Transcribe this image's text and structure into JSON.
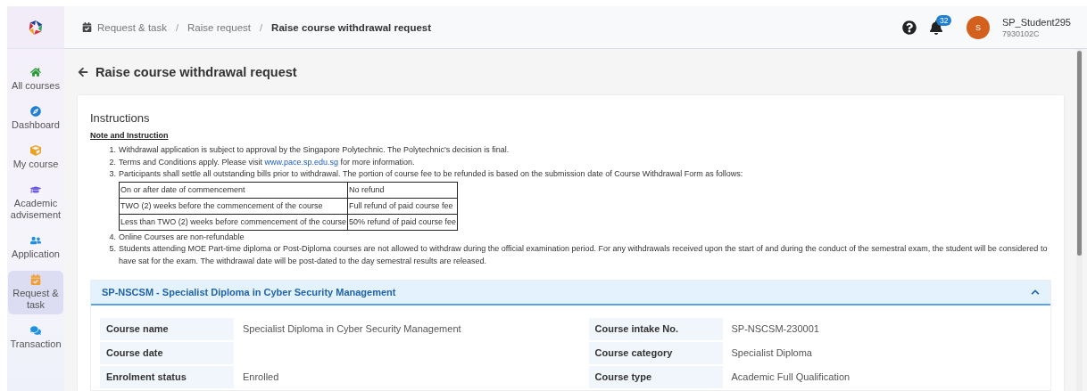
{
  "sidebar": {
    "items": [
      {
        "label": "All courses",
        "selected": false
      },
      {
        "label": "Dashboard",
        "selected": false
      },
      {
        "label": "My course",
        "selected": false
      },
      {
        "label": "Academic advisement",
        "selected": false
      },
      {
        "label": "Application",
        "selected": false
      },
      {
        "label": "Request & task",
        "selected": true
      },
      {
        "label": "Transaction",
        "selected": false
      }
    ]
  },
  "breadcrumb": [
    {
      "label": "Request & task",
      "current": false
    },
    {
      "separator": "/",
      "label": "Raise request",
      "current": false
    },
    {
      "separator": "/",
      "label": "Raise course withdrawal request",
      "current": true
    }
  ],
  "header": {
    "notifications": "32",
    "avatar": "S",
    "user_name": "SP_Student295",
    "user_id": "7930102C"
  },
  "page_title": "Raise course withdrawal request",
  "instructions": {
    "title": "Instructions",
    "subtitle": "Note and Instruction",
    "items": [
      {
        "marker": "1.",
        "text": "Withdrawal application is subject to approval by the Singapore Polytechnic. The Polytechnic's decision is final."
      },
      {
        "marker": "2.",
        "text": "Terms and Conditions apply. Please visit ",
        "link": "www.pace.sp.edu.sg",
        "after": " for more information."
      },
      {
        "marker": "3.",
        "text": "Participants shall settle all outstanding bills prior to withdrawal. The portion of course fee to be refunded is based on the submission date of Course Withdrawal Form as follows:",
        "table": [
          [
            "On or after date of commencement",
            "No refund"
          ],
          [
            "TWO (2) weeks before the commencement of the course",
            "Full refund of paid course fee"
          ],
          [
            "Less than TWO (2) weeks before commencement of the course",
            "50% refund of paid course fee"
          ]
        ]
      },
      {
        "marker": "4.",
        "text": "Online Courses are non-refundable"
      },
      {
        "marker": "5.",
        "text": "Students attending MOE Part-time diploma or Post-Diploma courses are not allowed to withdraw during the official examination period. For any withdrawals received upon the start of and during the conduct of the semestral exam, the student will be considered to have sat for the exam. The withdrawal date will be post-dated to the day semestral results are released."
      }
    ]
  },
  "course_panel": {
    "title": "SP-NSCSM - Specialist Diploma in Cyber Security Management",
    "expanded": true,
    "left": [
      {
        "label": "Course name",
        "value": "Specialist Diploma in Cyber Security Management"
      },
      {
        "label": "Course date"
      },
      {
        "label": "Enrolment status",
        "value": "Enrolled"
      }
    ],
    "right": [
      {
        "label": "Course intake No.",
        "value": "SP-NSCSM-230001"
      },
      {
        "label": "Course category",
        "value": "Specialist Diploma"
      },
      {
        "label": "Course type",
        "value": "Academic Full Qualification"
      }
    ]
  }
}
